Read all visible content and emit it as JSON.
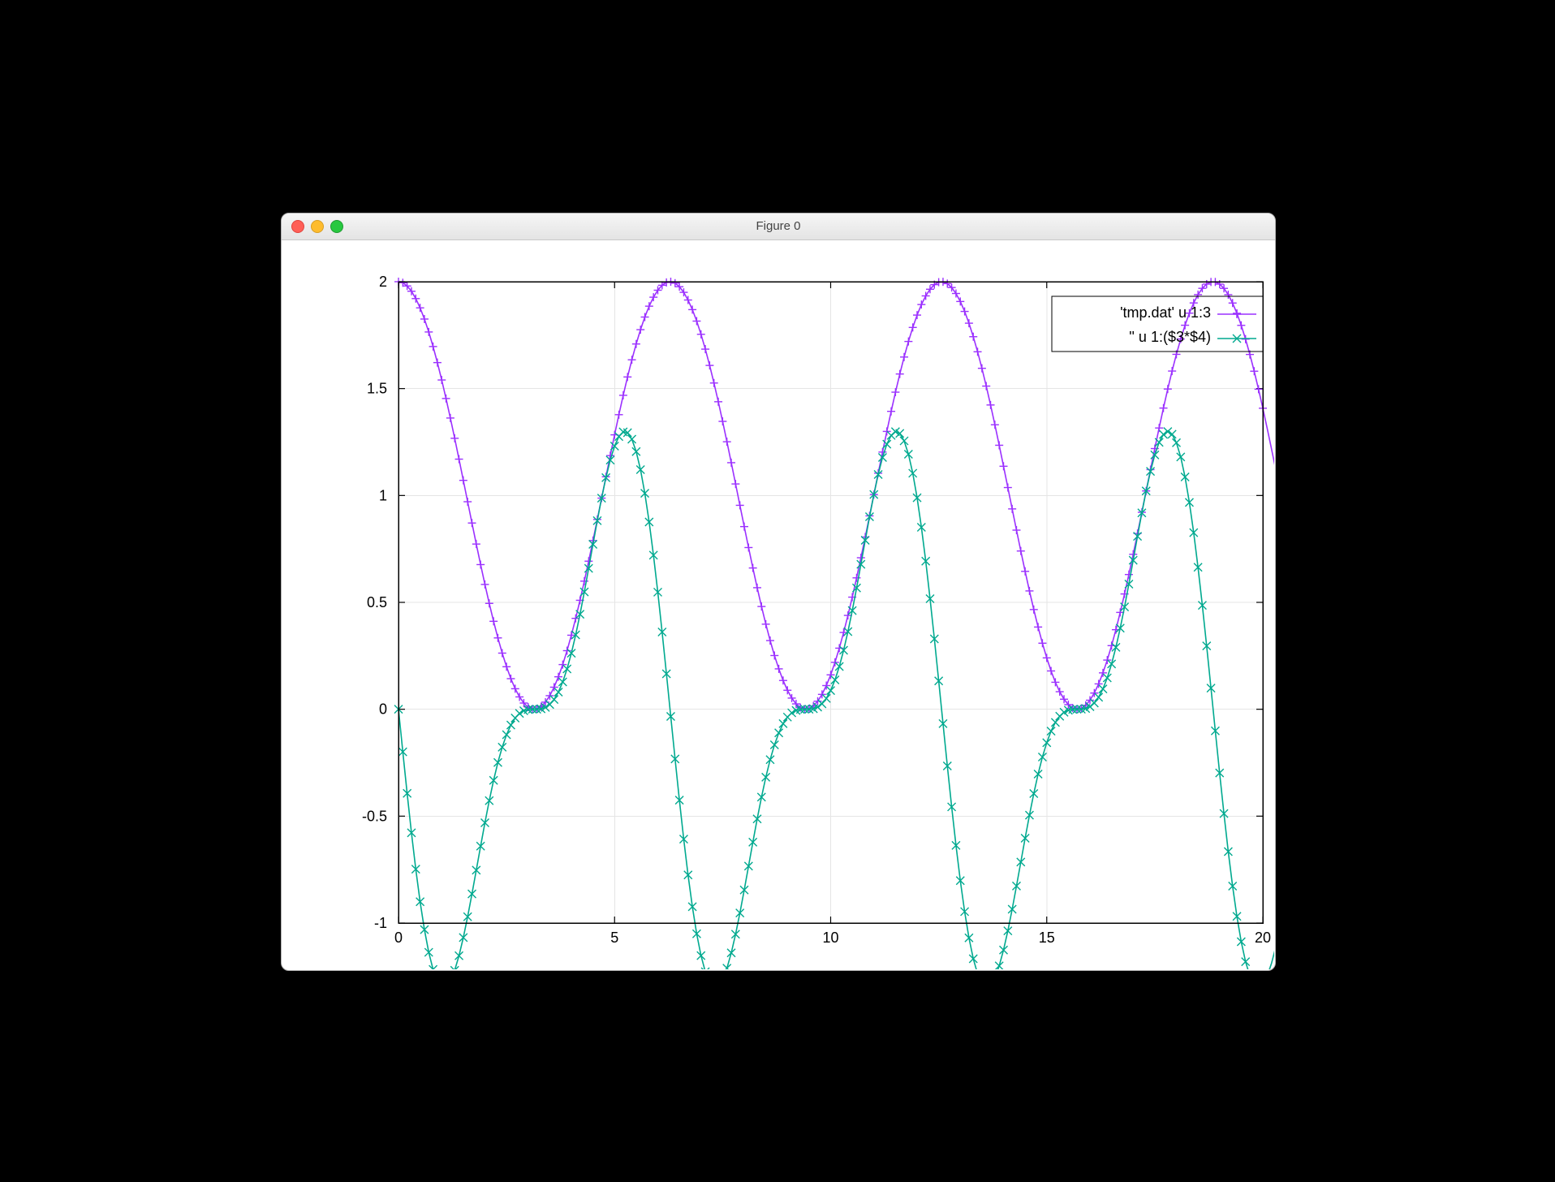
{
  "window": {
    "title": "Figure 0"
  },
  "chart_data": {
    "type": "line",
    "xlabel": "",
    "ylabel": "",
    "xlim": [
      0,
      20
    ],
    "ylim": [
      -1,
      2
    ],
    "xticks": [
      0,
      5,
      10,
      15,
      20
    ],
    "yticks": [
      -1,
      -0.5,
      0,
      0.5,
      1,
      1.5,
      2
    ],
    "grid": true,
    "legend_entries": [
      "'tmp.dat' u 1:3",
      "'' u 1:($3*$4)"
    ],
    "series": [
      {
        "name": "'tmp.dat' u 1:3",
        "color": "#9b30ff",
        "marker": "plus",
        "formula": "1 + cos(x)",
        "x_sample": {
          "start": 0,
          "end": 20.4,
          "step": 0.1
        }
      },
      {
        "name": "'' u 1:($3*$4)",
        "color": "#00a98f",
        "marker": "x",
        "formula": "-sin(x)*(1+cos(x))",
        "x_sample": {
          "start": 0,
          "end": 20.4,
          "step": 0.1
        }
      }
    ]
  }
}
